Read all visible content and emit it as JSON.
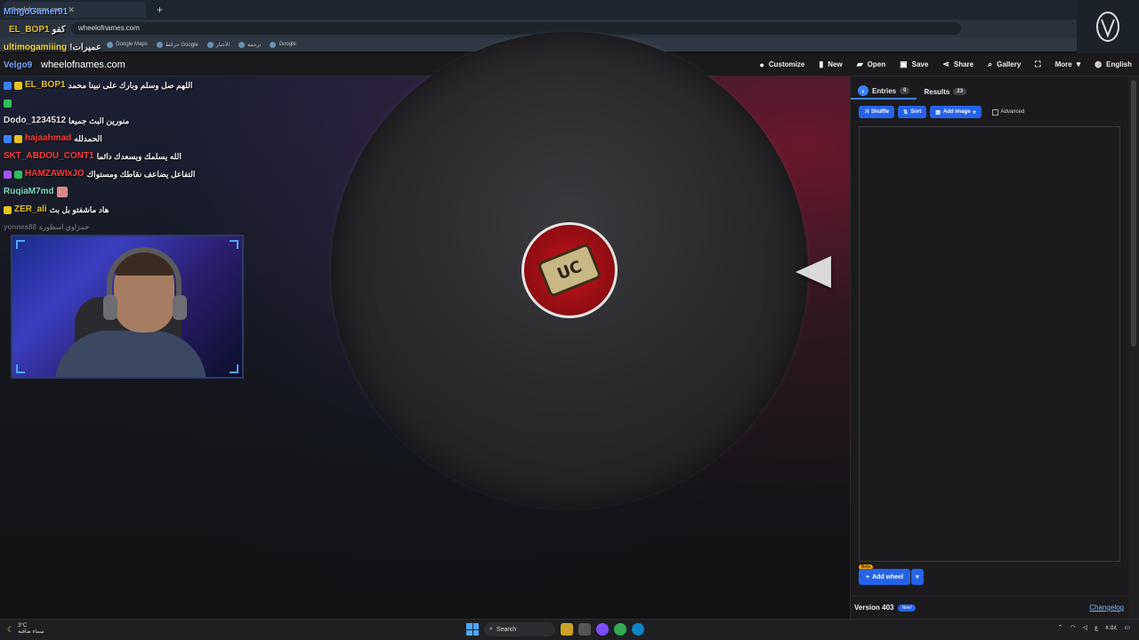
{
  "browser": {
    "tab_title": "wheelofnames.com",
    "address": "wheelofnames.com",
    "bookmarks": [
      "Google Maps",
      "خرائط Google",
      "الأخبار",
      "ترجمة",
      "Google"
    ]
  },
  "navbar": {
    "brand": "wheelofnames.com",
    "items": [
      {
        "label": "Customize",
        "icon": "palette-icon"
      },
      {
        "label": "New",
        "icon": "file-icon"
      },
      {
        "label": "Open",
        "icon": "folder-icon"
      },
      {
        "label": "Save",
        "icon": "save-icon"
      },
      {
        "label": "Share",
        "icon": "share-icon"
      },
      {
        "label": "Gallery",
        "icon": "search-icon"
      },
      {
        "label": "",
        "icon": "fullscreen-icon"
      },
      {
        "label": "More",
        "icon": "chevron-down-icon"
      },
      {
        "label": "English",
        "icon": "globe-icon"
      }
    ]
  },
  "overlay": {
    "top": [
      {
        "user": "MingoGamer91",
        "text": "",
        "color": "#7aa6ff"
      },
      {
        "user": "EL_BOP1",
        "text": "كفو",
        "color": "#e6c21f"
      },
      {
        "user": "ultimogamiiing",
        "text": "!عميرات",
        "color": "#ffde3a"
      },
      {
        "user": "Velgo9",
        "text": "",
        "color": "#7aa6ff"
      }
    ],
    "chat": [
      {
        "user": "EL_BOP1",
        "text": "اللهم صل وسلم وبارك على نبينا محمد",
        "color": "#e6c21f"
      },
      {
        "user": "Dodo_1234512",
        "text": "منورين البث جميعا",
        "color": "#e8e8e8"
      },
      {
        "user": "hajaahmad",
        "text": "الحمدلله",
        "color": "#ff3b3b"
      },
      {
        "user": "SKT_ABDOU_CONT1",
        "text": "الله يسلمك ويسعدك دائما",
        "color": "#ff3b3b"
      },
      {
        "user": "HAMZAWIxJO",
        "text": "التفاعل يضاعف نقاطك ومستواك",
        "color": "#ff3b3b"
      },
      {
        "user": "RuqiaM7md",
        "text": "",
        "color": "#7be0c6"
      },
      {
        "user": "ZER_ali",
        "text": "هاد ماشفتو بل بث",
        "color": "#e6c21f"
      },
      {
        "user": "yonnes88",
        "text": "حمزاوي اسطوره",
        "color": "#9a9aa6"
      }
    ]
  },
  "wheel": {
    "hub_text": "UC",
    "colors": {
      "hub": "#c3141a",
      "pointer": "#d9d9d9"
    }
  },
  "panel": {
    "tabs": [
      {
        "label": "Entries",
        "count": "0"
      },
      {
        "label": "Results",
        "count": "23"
      }
    ],
    "actions": {
      "shuffle": "Shuffle",
      "sort": "Sort",
      "add_image": "Add image",
      "advanced": "Advanced"
    },
    "add_wheel": "Add wheel",
    "beta": "Beta",
    "version": "Version 403",
    "new_badge": "New!",
    "changelog": "Changelog",
    "accent": "#2563eb"
  },
  "taskbar": {
    "weather_temp": "3°C",
    "weather_desc": "سماء صافية",
    "search": "Search",
    "tray": [
      "ع",
      "٨:٥٤"
    ]
  }
}
